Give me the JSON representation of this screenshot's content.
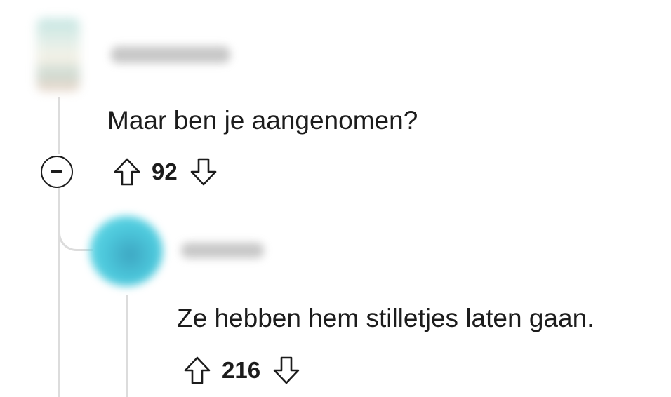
{
  "comments": [
    {
      "username": "user",
      "text": "Maar ben je aangenomen?",
      "score": "92",
      "icons": {
        "avatar": "avatar-icon",
        "collapse": "collapse-minus-icon",
        "upvote": "arrow-up-icon",
        "downvote": "arrow-down-icon"
      }
    },
    {
      "username": "user",
      "text": "Ze hebben hem stilletjes laten gaan.",
      "score": "216",
      "icons": {
        "avatar": "avatar-icon",
        "upvote": "arrow-up-icon",
        "downvote": "arrow-down-icon"
      }
    }
  ],
  "colors": {
    "text": "#1c1c1c",
    "thread_line": "#dcdcdc",
    "avatar_reply": "#4cc7db",
    "background": "#ffffff"
  }
}
